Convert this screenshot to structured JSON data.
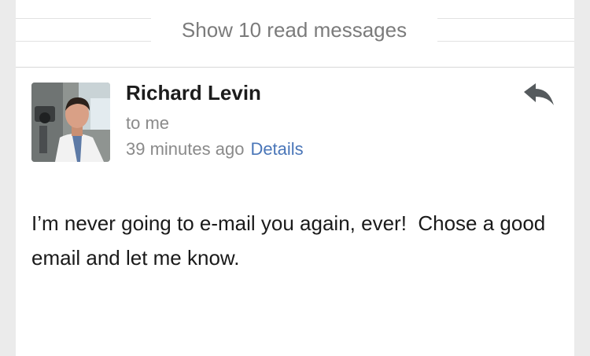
{
  "thread": {
    "show_read_label": "Show 10 read messages"
  },
  "message": {
    "sender_name": "Richard Levin",
    "recipient_text": "to me",
    "timestamp": "39 minutes ago",
    "details_label": "Details",
    "body": "I’m never going to e-mail you again, ever!  Chose a good email and let me know."
  },
  "icons": {
    "reply": "reply-arrow-icon",
    "avatar": "sender-avatar"
  },
  "colors": {
    "link": "#4a76b8",
    "secondary_text": "#8a8a8a",
    "primary_text": "#1a1a1a",
    "background": "#ebebeb"
  }
}
